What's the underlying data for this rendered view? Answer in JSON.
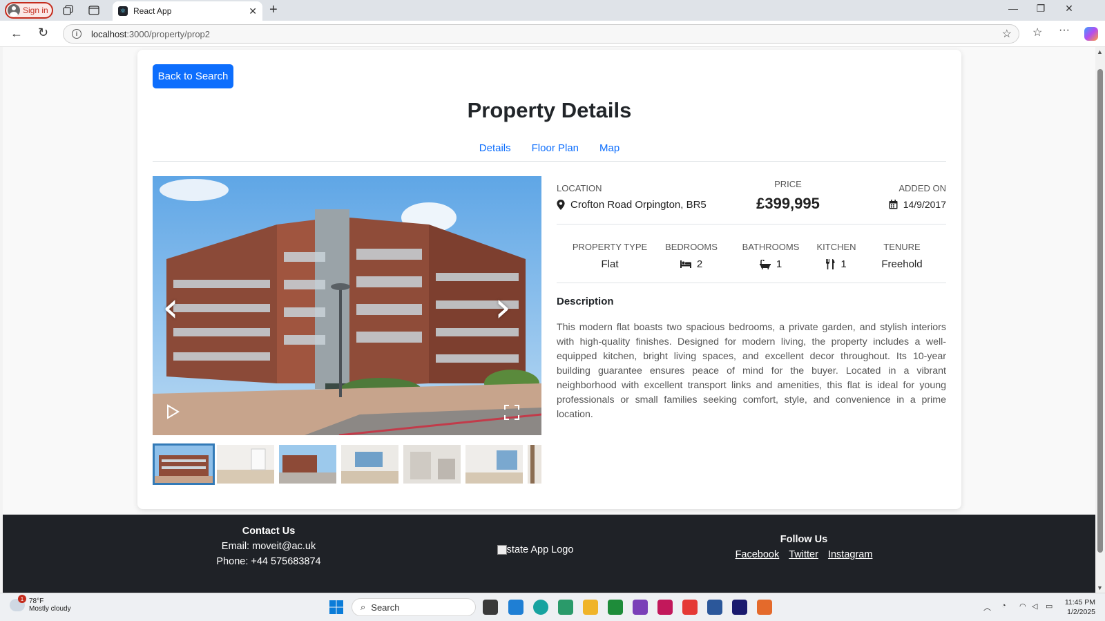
{
  "browser": {
    "signin_label": "Sign in",
    "tab_title": "React App",
    "url_host": "localhost",
    "url_path": ":3000/property/prop2"
  },
  "page": {
    "back_button": "Back to Search",
    "title": "Property Details",
    "tabs": [
      "Details",
      "Floor Plan",
      "Map"
    ]
  },
  "property": {
    "location_label": "LOCATION",
    "location": "Crofton Road Orpington, BR5",
    "price_label": "PRICE",
    "price": "£399,995",
    "added_label": "ADDED ON",
    "added": "14/9/2017",
    "stats": [
      {
        "label": "PROPERTY TYPE",
        "value": "Flat",
        "icon": ""
      },
      {
        "label": "BEDROOMS",
        "value": "2",
        "icon": "bed-icon"
      },
      {
        "label": "BATHROOMS",
        "value": "1",
        "icon": "bath-icon"
      },
      {
        "label": "KITCHEN",
        "value": "1",
        "icon": "utensils-icon"
      },
      {
        "label": "TENURE",
        "value": "Freehold",
        "icon": ""
      }
    ],
    "description_heading": "Description",
    "description": "This modern flat boasts two spacious bedrooms, a private garden, and stylish interiors with high-quality finishes. Designed for modern living, the property includes a well-equipped kitchen, bright living spaces, and excellent decor throughout. Its 10-year building guarantee ensures peace of mind for the buyer. Located in a vibrant neighborhood with excellent transport links and amenities, this flat is ideal for young professionals or small families seeking comfort, style, and convenience in a prime location."
  },
  "footer": {
    "contact_heading": "Contact Us",
    "email": "Email: moveit@ac.uk",
    "phone": "Phone: +44 575683874",
    "logo_alt": "Estate App Logo",
    "follow_heading": "Follow Us",
    "links": [
      "Facebook",
      "Twitter",
      "Instagram"
    ]
  },
  "taskbar": {
    "temp": "78°F",
    "weather": "Mostly cloudy",
    "weather_badge": "1",
    "search_label": "Search",
    "time": "11:45 PM",
    "date": "1/2/2025"
  },
  "colors": {
    "primary": "#0d6efd",
    "footer_bg": "#1f2227",
    "thumb_active": "#337ab7"
  }
}
